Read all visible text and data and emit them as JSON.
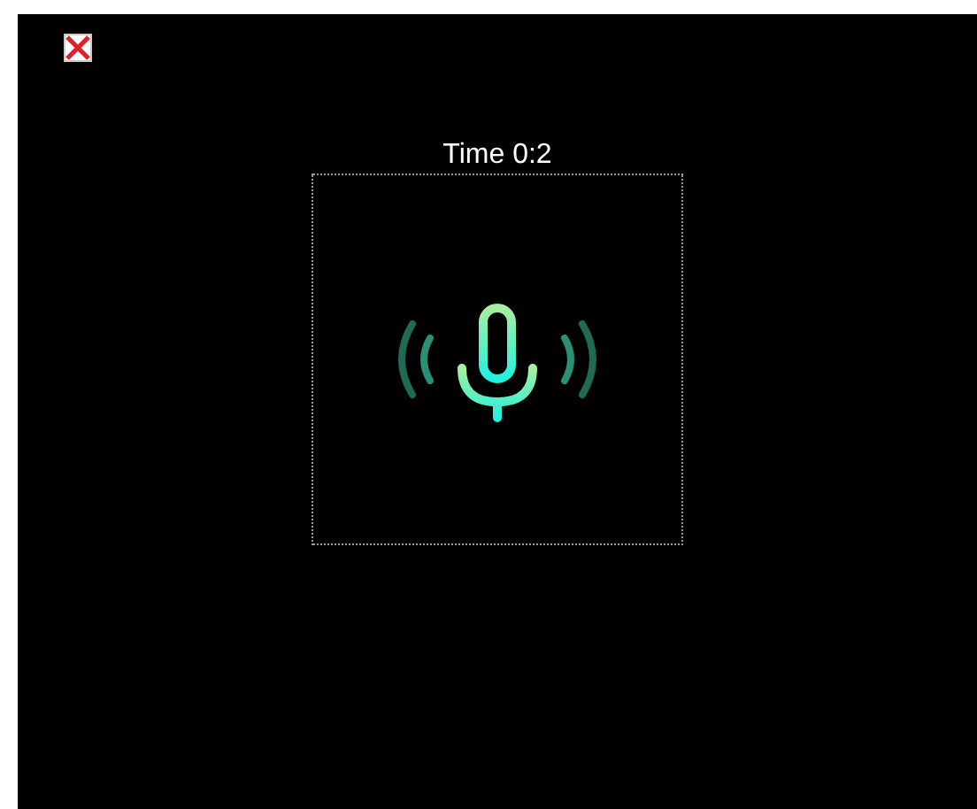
{
  "recorder": {
    "timer": "Time 0:2"
  }
}
